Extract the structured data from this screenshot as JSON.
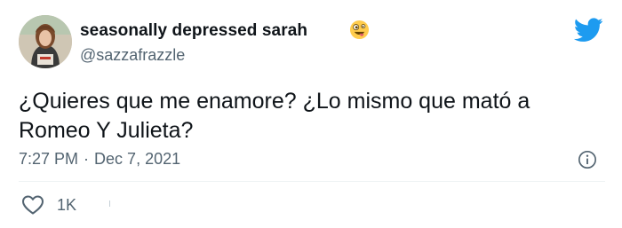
{
  "author": {
    "display_name": "seasonally depressed sarah",
    "handle": "@sazzafrazzle",
    "emoji": "zany-face-emoji",
    "avatar": "avatar"
  },
  "tweet": {
    "text": "¿Quieres que me enamore? ¿Lo mismo que mató a Romeo Y Julieta?",
    "time": "7:27 PM",
    "separator": "·",
    "date": "Dec 7, 2021"
  },
  "actions": {
    "like_count": "1K"
  },
  "icons": {
    "brand": "twitter-bird-icon",
    "info": "info-icon",
    "like": "heart-icon"
  },
  "colors": {
    "brand_blue": "#1d9bf0",
    "secondary_text": "#536471",
    "primary_text": "#0f1419"
  }
}
